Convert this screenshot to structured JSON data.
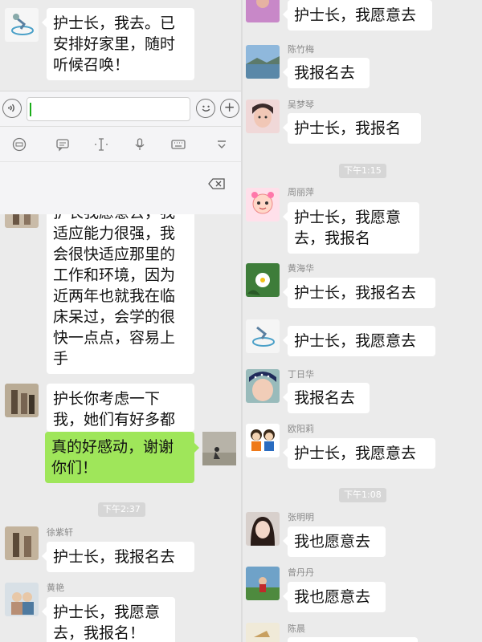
{
  "left_column": {
    "messages": [
      {
        "text": "护士长，我去。已安排好家里，随时听候召唤！"
      },
      {
        "text": "护长我愿意去，我适应能力很强，我会很快适应那里的工作和环境，因为近两年也就我在临床呆过，会学的很快一点点，容易上手"
      },
      {
        "text": "护长你考虑一下我，她们有好多都"
      },
      {
        "text": "真的好感动，谢谢你们！"
      },
      {
        "sender": "徐紫轩",
        "text": "护士长，我报名去"
      },
      {
        "sender": "黄艳",
        "text": "护士长，我愿意去，我报名！"
      }
    ],
    "time_label": "下午2:37"
  },
  "input": {
    "value": "",
    "voice_icon": "voice-icon",
    "emoji_icon": "emoji-icon",
    "plus_icon": "plus-icon"
  },
  "toolbar": {
    "tools": [
      "emoji-keyboard-icon",
      "message-icon",
      "cursor-icon",
      "microphone-icon",
      "keyboard-icon",
      "collapse-icon"
    ],
    "delete_icon": "backspace-icon"
  },
  "right_column": {
    "messages": [
      {
        "text": "护士长，我愿意去"
      },
      {
        "sender": "陈竹梅",
        "text": "我报名去"
      },
      {
        "sender": "吴梦琴",
        "text": "护士长，我报名"
      },
      {
        "sender": "周丽萍",
        "text": "护士长，我愿意去，我报名"
      },
      {
        "sender": "黄海华",
        "text": "护士长，我报名去"
      },
      {
        "text": "护士长，我愿意去"
      },
      {
        "sender": "丁日华",
        "text": "我报名去"
      },
      {
        "sender": "欧阳莉",
        "text": "护士长，我愿意去"
      },
      {
        "sender": "张明明",
        "text": "我也愿意去"
      },
      {
        "sender": "曾丹丹",
        "text": "我也愿意去"
      },
      {
        "sender": "陈晨",
        "text": ""
      }
    ],
    "time_labels": [
      "下午1:15",
      "下午1:08"
    ]
  },
  "colors": {
    "background": "#ebebeb",
    "bubble": "#ffffff",
    "self_bubble": "#9fe65a",
    "time_badge": "#d6d6d6"
  }
}
